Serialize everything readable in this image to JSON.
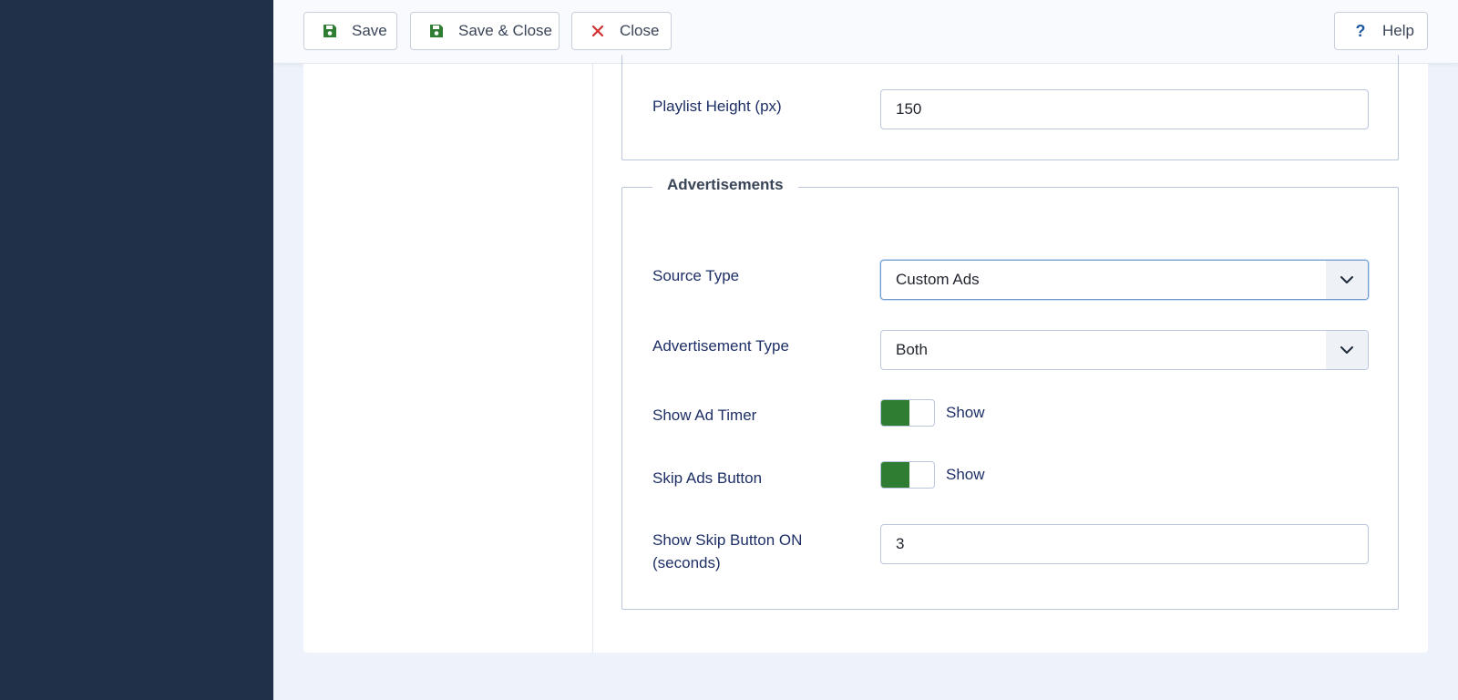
{
  "toolbar": {
    "save_label": "Save",
    "save_close_label": "Save & Close",
    "close_label": "Close",
    "help_label": "Help"
  },
  "colors": {
    "sidebar": "#213049",
    "toggle_on": "#2e7d32",
    "save_icon": "#2e7d32",
    "close_icon": "#d32f2f",
    "help_icon": "#1e5aa0"
  },
  "playlist": {
    "height_label": "Playlist Height (px)",
    "height_value": "150"
  },
  "advertisements": {
    "legend": "Advertisements",
    "source_type_label": "Source Type",
    "source_type_value": "Custom Ads",
    "ad_type_label": "Advertisement Type",
    "ad_type_value": "Both",
    "show_ad_timer_label": "Show Ad Timer",
    "show_ad_timer_state": "Show",
    "skip_ads_label": "Skip Ads Button",
    "skip_ads_state": "Show",
    "skip_on_label_line1": "Show Skip Button ON",
    "skip_on_label_line2": "(seconds)",
    "skip_on_value": "3"
  }
}
